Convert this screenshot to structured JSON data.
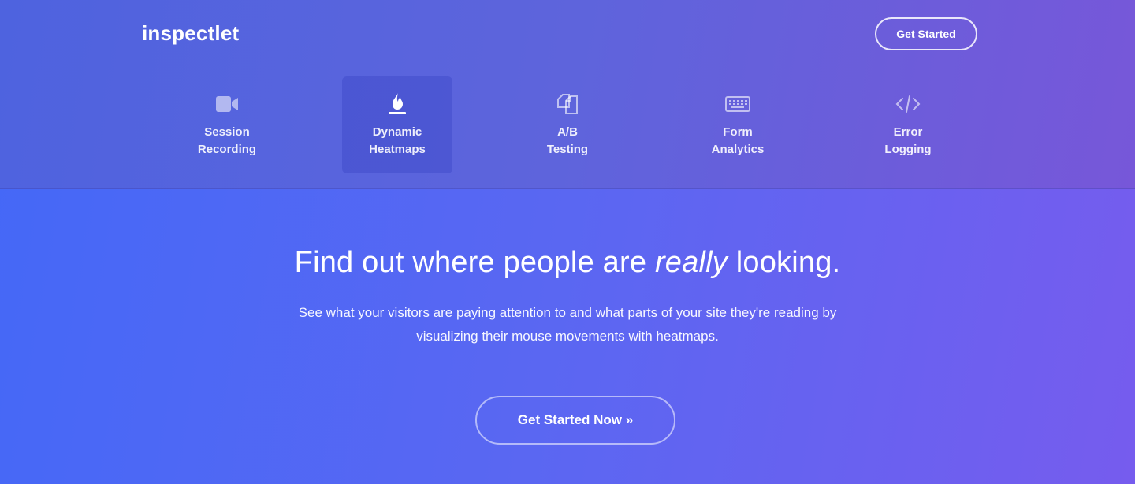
{
  "header": {
    "logo": "inspectlet",
    "cta_label": "Get Started"
  },
  "features": [
    {
      "icon": "video-camera-icon",
      "line1": "Session",
      "line2": "Recording",
      "active": false
    },
    {
      "icon": "flame-icon",
      "line1": "Dynamic",
      "line2": "Heatmaps",
      "active": true
    },
    {
      "icon": "copy-pages-icon",
      "line1": "A/B",
      "line2": "Testing",
      "active": false
    },
    {
      "icon": "keyboard-icon",
      "line1": "Form",
      "line2": "Analytics",
      "active": false
    },
    {
      "icon": "code-icon",
      "line1": "Error",
      "line2": "Logging",
      "active": false
    }
  ],
  "hero": {
    "headline_start": "Find out where people are ",
    "headline_emphasis": "really",
    "headline_end": " looking.",
    "subtext": "See what your visitors are paying attention to and what parts of your site they're reading by visualizing their mouse movements with heatmaps.",
    "cta_label": "Get Started Now »"
  },
  "colors": {
    "background_start": "#4468f7",
    "background_end": "#765cee",
    "nav_start": "#4e63df",
    "nav_end": "#7757d9"
  }
}
